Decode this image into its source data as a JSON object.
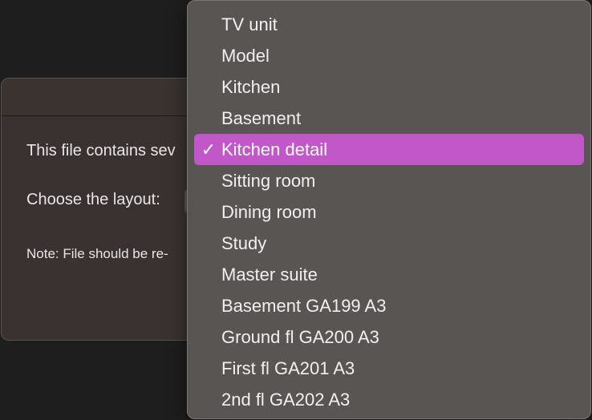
{
  "dialog": {
    "message": "This file contains sev",
    "choose_label": "Choose the layout:",
    "note": "Note: File should be re-"
  },
  "menu": {
    "selected_index": 4,
    "items": [
      {
        "label": "TV unit"
      },
      {
        "label": "Model"
      },
      {
        "label": "Kitchen"
      },
      {
        "label": "Basement"
      },
      {
        "label": "Kitchen detail",
        "checked": true
      },
      {
        "label": "Sitting room"
      },
      {
        "label": "Dining room"
      },
      {
        "label": "Study"
      },
      {
        "label": "Master suite"
      },
      {
        "label": "Basement GA199 A3"
      },
      {
        "label": "Ground fl GA200 A3"
      },
      {
        "label": "First fl GA201 A3"
      },
      {
        "label": "2nd fl GA202 A3"
      }
    ],
    "check_glyph": "✓",
    "highlight_color": "#c257c9"
  }
}
